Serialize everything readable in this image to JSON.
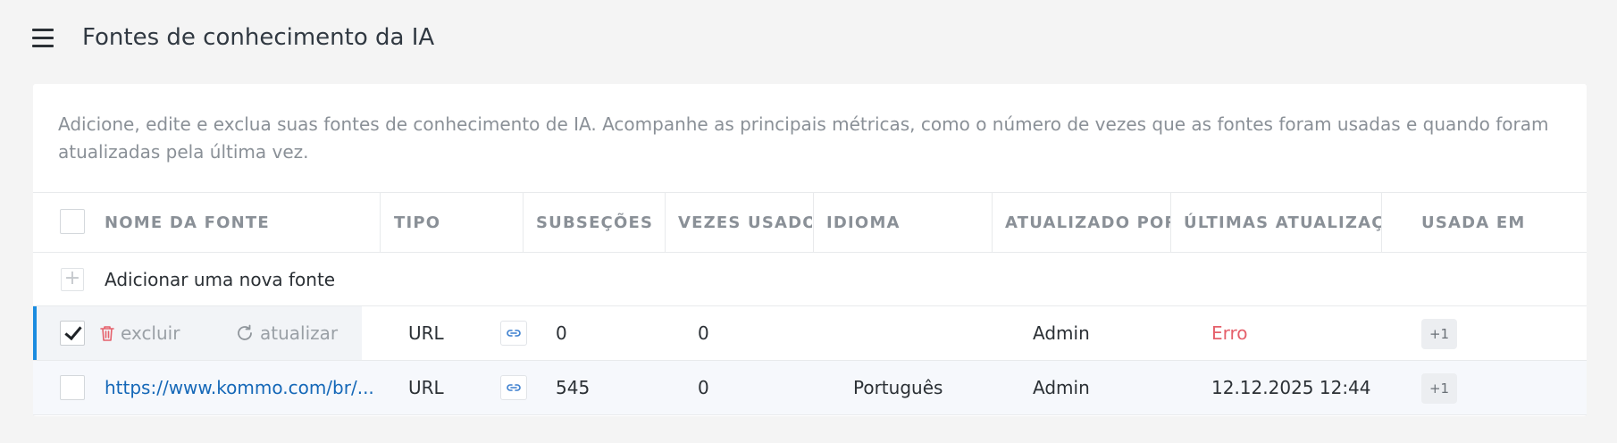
{
  "header": {
    "title": "Fontes de conhecimento da IA"
  },
  "card": {
    "description": "Adicione, edite e exclua suas fontes de conhecimento de IA. Acompanhe as principais métricas, como o número de vezes que as fontes foram usadas e quando foram atualizadas pela última vez."
  },
  "table": {
    "columns": [
      "NOME DA FONTE",
      "TIPO",
      "SUBSEÇÕES",
      "VEZES USADO",
      "IDIOMA",
      "ATUALIZADO POR",
      "ÚLTIMAS ATUALIZAÇÕ",
      "USADA EM"
    ],
    "add_label": "Adicionar uma nova fonte",
    "actions": {
      "delete_label": "excluir",
      "update_label": "atualizar"
    },
    "rows": [
      {
        "selected": true,
        "name": "",
        "type": "URL",
        "subsections": "0",
        "times_used": "0",
        "language": "",
        "updated_by": "Admin",
        "last_update": "Erro",
        "used_in": "+1"
      },
      {
        "selected": false,
        "name": "https://www.kommo.com/br/...",
        "type": "URL",
        "subsections": "545",
        "times_used": "0",
        "language": "Português",
        "updated_by": "Admin",
        "last_update": "12.12.2025 12:44",
        "used_in": "+1"
      }
    ]
  },
  "colors": {
    "accent": "#1b8ce0",
    "link": "#1568b8",
    "error": "#e5606b",
    "background": "#f4f4f4"
  },
  "icons": [
    "hamburger-menu-icon",
    "plus-icon",
    "checkmark-icon",
    "trash-icon",
    "refresh-icon",
    "link-icon"
  ]
}
